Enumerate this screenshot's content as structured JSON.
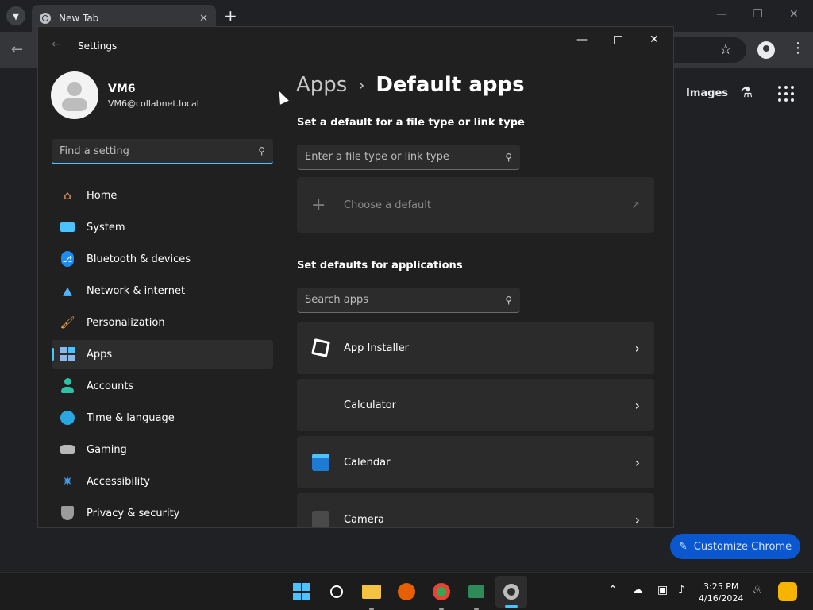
{
  "chrome": {
    "tab_title": "New Tab",
    "images_link": "Images",
    "customize_button": "Customize Chrome"
  },
  "settings": {
    "window_title": "Settings",
    "user": {
      "name": "VM6",
      "email": "VM6@collabnet.local"
    },
    "search_placeholder": "Find a setting",
    "nav": [
      {
        "label": "Home",
        "icon": "home-icon",
        "color": "#f2a06e"
      },
      {
        "label": "System",
        "icon": "system-icon",
        "color": "#4cc2ff"
      },
      {
        "label": "Bluetooth & devices",
        "icon": "bluetooth-icon",
        "color": "#1d8cf0"
      },
      {
        "label": "Network & internet",
        "icon": "wifi-icon",
        "color": "#52b4ff"
      },
      {
        "label": "Personalization",
        "icon": "brush-icon",
        "color": "#e4a84a"
      },
      {
        "label": "Apps",
        "icon": "apps-icon",
        "color": "#8fb7e8",
        "active": true
      },
      {
        "label": "Accounts",
        "icon": "accounts-icon",
        "color": "#2fc2a4"
      },
      {
        "label": "Time & language",
        "icon": "globe-clock-icon",
        "color": "#2aa7e0"
      },
      {
        "label": "Gaming",
        "icon": "gamepad-icon",
        "color": "#b8b8b8"
      },
      {
        "label": "Accessibility",
        "icon": "accessibility-icon",
        "color": "#3b9df0"
      },
      {
        "label": "Privacy & security",
        "icon": "shield-icon",
        "color": "#9b9b9b"
      }
    ],
    "breadcrumb": {
      "parent": "Apps",
      "current": "Default apps"
    },
    "file_type_section": "Set a default for a file type or link type",
    "file_type_placeholder": "Enter a file type or link type",
    "choose_default": "Choose a default",
    "applications_section": "Set defaults for applications",
    "apps_placeholder": "Search apps",
    "apps": [
      {
        "name": "App Installer",
        "icon": "package-icon"
      },
      {
        "name": "Calculator",
        "icon": "calculator-icon"
      },
      {
        "name": "Calendar",
        "icon": "calendar-icon"
      },
      {
        "name": "Camera",
        "icon": "camera-icon"
      }
    ]
  },
  "taskbar": {
    "time": "3:25 PM",
    "date": "4/16/2024"
  },
  "colors": {
    "accent": "#4cc2ff",
    "window_bg": "#202020",
    "card_bg": "#2b2b2b"
  }
}
